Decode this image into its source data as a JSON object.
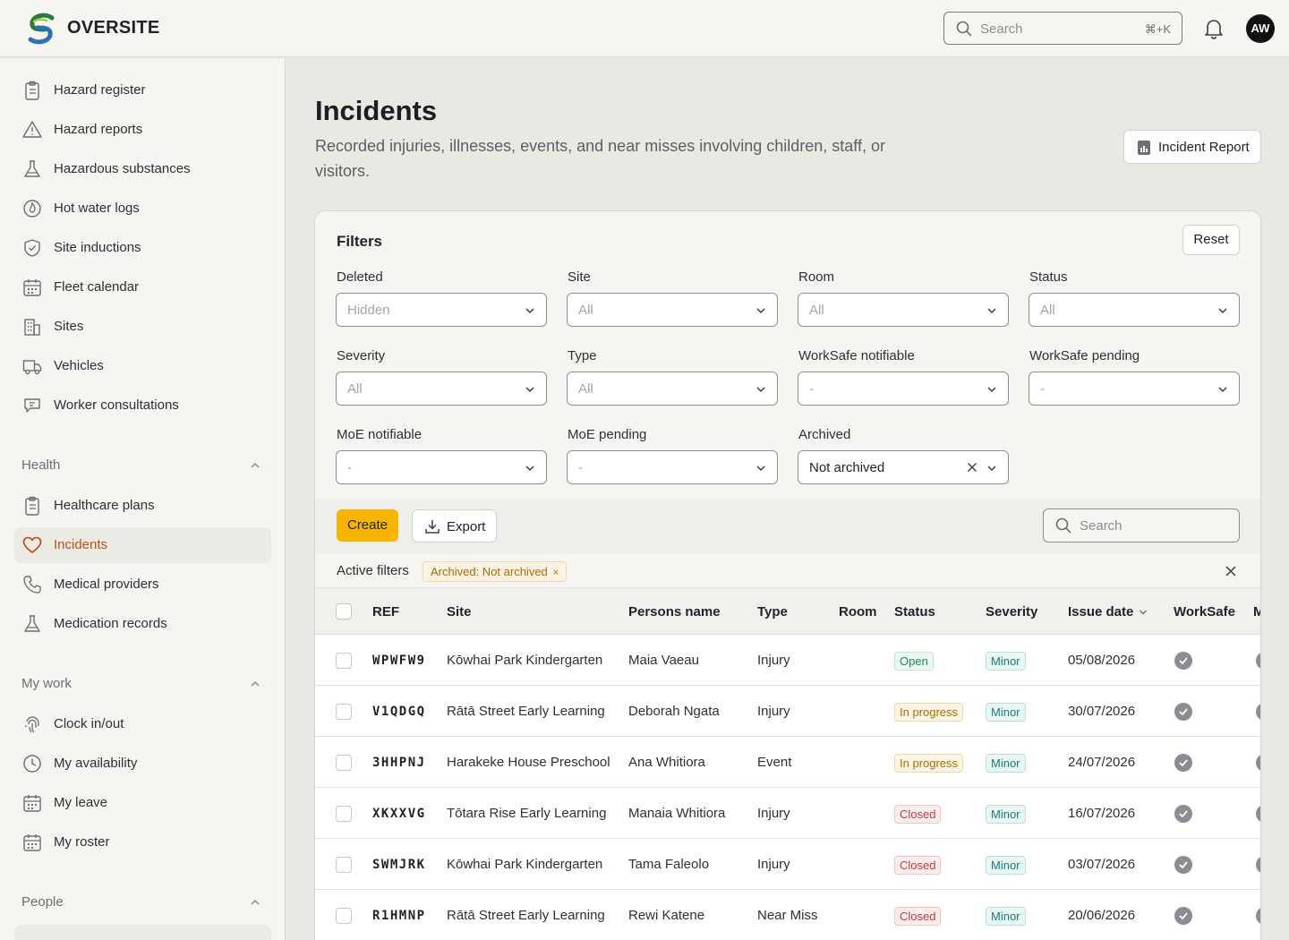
{
  "app": {
    "brand": "OVERSITE",
    "user_initials": "AW"
  },
  "topbar": {
    "search_placeholder": "Search",
    "search_shortcut": "⌘+K"
  },
  "sidebar": {
    "items_top": [
      {
        "label": "Hazard register",
        "icon": "clipboard-icon"
      },
      {
        "label": "Hazard reports",
        "icon": "warning-icon"
      },
      {
        "label": "Hazardous substances",
        "icon": "flask-icon"
      },
      {
        "label": "Hot water logs",
        "icon": "flame-icon"
      },
      {
        "label": "Site inductions",
        "icon": "shield-check-icon"
      },
      {
        "label": "Fleet calendar",
        "icon": "calendar-icon"
      },
      {
        "label": "Sites",
        "icon": "building-icon"
      },
      {
        "label": "Vehicles",
        "icon": "truck-icon"
      },
      {
        "label": "Worker consultations",
        "icon": "chat-icon"
      }
    ],
    "health": {
      "title": "Health",
      "items": [
        {
          "label": "Healthcare plans",
          "icon": "clipboard-icon"
        },
        {
          "label": "Incidents",
          "icon": "heart-icon",
          "active": true
        },
        {
          "label": "Medical providers",
          "icon": "phone-icon"
        },
        {
          "label": "Medication records",
          "icon": "flask-icon"
        }
      ]
    },
    "mywork": {
      "title": "My work",
      "items": [
        {
          "label": "Clock in/out",
          "icon": "fingerprint-icon"
        },
        {
          "label": "My availability",
          "icon": "clock-icon"
        },
        {
          "label": "My leave",
          "icon": "calendar-icon"
        },
        {
          "label": "My roster",
          "icon": "calendar-icon"
        }
      ]
    },
    "people": {
      "title": "People"
    }
  },
  "page": {
    "title": "Incidents",
    "subtitle": "Recorded injuries, illnesses, events, and near misses involving children, staff, or visitors.",
    "report_button": "Incident Report"
  },
  "filters": {
    "title": "Filters",
    "reset": "Reset",
    "fields": [
      {
        "label": "Deleted",
        "value": "Hidden"
      },
      {
        "label": "Site",
        "value": "All"
      },
      {
        "label": "Room",
        "value": "All"
      },
      {
        "label": "Status",
        "value": "All"
      },
      {
        "label": "Severity",
        "value": "All"
      },
      {
        "label": "Type",
        "value": "All"
      },
      {
        "label": "WorkSafe notifiable",
        "value": "-"
      },
      {
        "label": "WorkSafe pending",
        "value": "-"
      },
      {
        "label": "MoE notifiable",
        "value": "-"
      },
      {
        "label": "MoE pending",
        "value": "-"
      },
      {
        "label": "Archived",
        "value": "Not archived"
      }
    ]
  },
  "toolbar": {
    "create": "Create",
    "export": "Export",
    "search_placeholder": "Search"
  },
  "active_filters": {
    "label": "Active filters",
    "chips": [
      "Archived: Not archived"
    ],
    "chip_remove": "×"
  },
  "table": {
    "columns": [
      "REF",
      "Site",
      "Persons name",
      "Type",
      "Room",
      "Status",
      "Severity",
      "Issue date",
      "WorkSafe",
      "M"
    ],
    "rows": [
      {
        "ref": "WPWFW9",
        "site": "Kōwhai Park Kindergarten",
        "person": "Maia Vaeau",
        "type": "Injury",
        "room": "",
        "status": "Open",
        "severity": "Minor",
        "date": "05/08/2026"
      },
      {
        "ref": "V1QDGQ",
        "site": "Rātā Street Early Learning",
        "person": "Deborah Ngata",
        "type": "Injury",
        "room": "",
        "status": "In progress",
        "severity": "Minor",
        "date": "30/07/2026"
      },
      {
        "ref": "3HHPNJ",
        "site": "Harakeke House Preschool",
        "person": "Ana Whitiora",
        "type": "Event",
        "room": "",
        "status": "In progress",
        "severity": "Minor",
        "date": "24/07/2026"
      },
      {
        "ref": "XKXXVG",
        "site": "Tōtara Rise Early Learning",
        "person": "Manaia Whitiora",
        "type": "Injury",
        "room": "",
        "status": "Closed",
        "severity": "Minor",
        "date": "16/07/2026"
      },
      {
        "ref": "SWMJRK",
        "site": "Kōwhai Park Kindergarten",
        "person": "Tama Faleolo",
        "type": "Injury",
        "room": "",
        "status": "Closed",
        "severity": "Minor",
        "date": "03/07/2026"
      },
      {
        "ref": "R1HMNP",
        "site": "Rātā Street Early Learning",
        "person": "Rewi Katene",
        "type": "Near Miss",
        "room": "",
        "status": "Closed",
        "severity": "Minor",
        "date": "20/06/2026"
      }
    ]
  },
  "colors": {
    "accent": "#f7b500",
    "active_nav": "#b8550f",
    "open": "#1c8a5c",
    "in_progress": "#b06a00",
    "closed": "#c23a3a",
    "minor": "#17807a"
  }
}
